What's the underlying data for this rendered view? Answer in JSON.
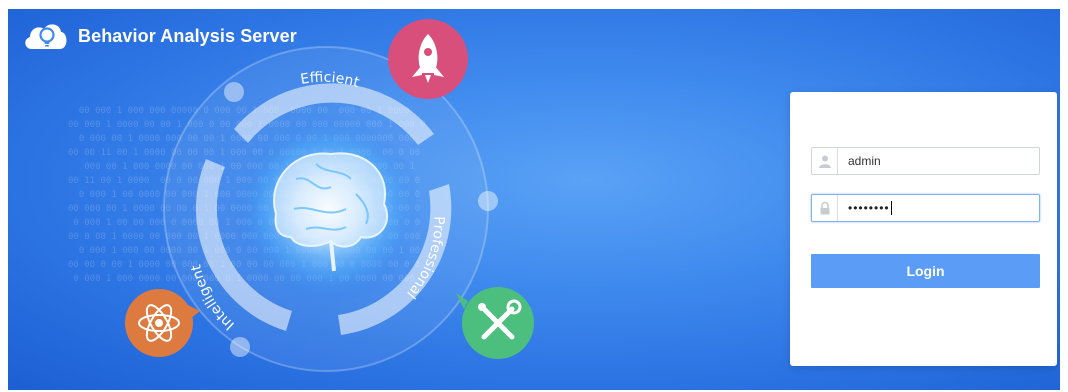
{
  "app": {
    "title": "Behavior Analysis Server"
  },
  "hero": {
    "labels": {
      "top": "Efficient",
      "right": "Professional",
      "left": "Intelligent"
    },
    "icons": {
      "top": "rocket-icon",
      "bottom_left": "atom-icon",
      "bottom_right": "tools-icon",
      "center": "brain-icon"
    },
    "colors": {
      "rocket_badge": "#d94f7c",
      "atom_badge": "#dd7a3f",
      "tools_badge": "#4cbf7e",
      "background": "#3f8aee"
    }
  },
  "login": {
    "username": {
      "value": "admin",
      "icon": "user-icon"
    },
    "password": {
      "masked_value": "••••••••",
      "icon": "lock-icon"
    },
    "submit_label": "Login",
    "button_color": "#5b9cf6"
  }
}
